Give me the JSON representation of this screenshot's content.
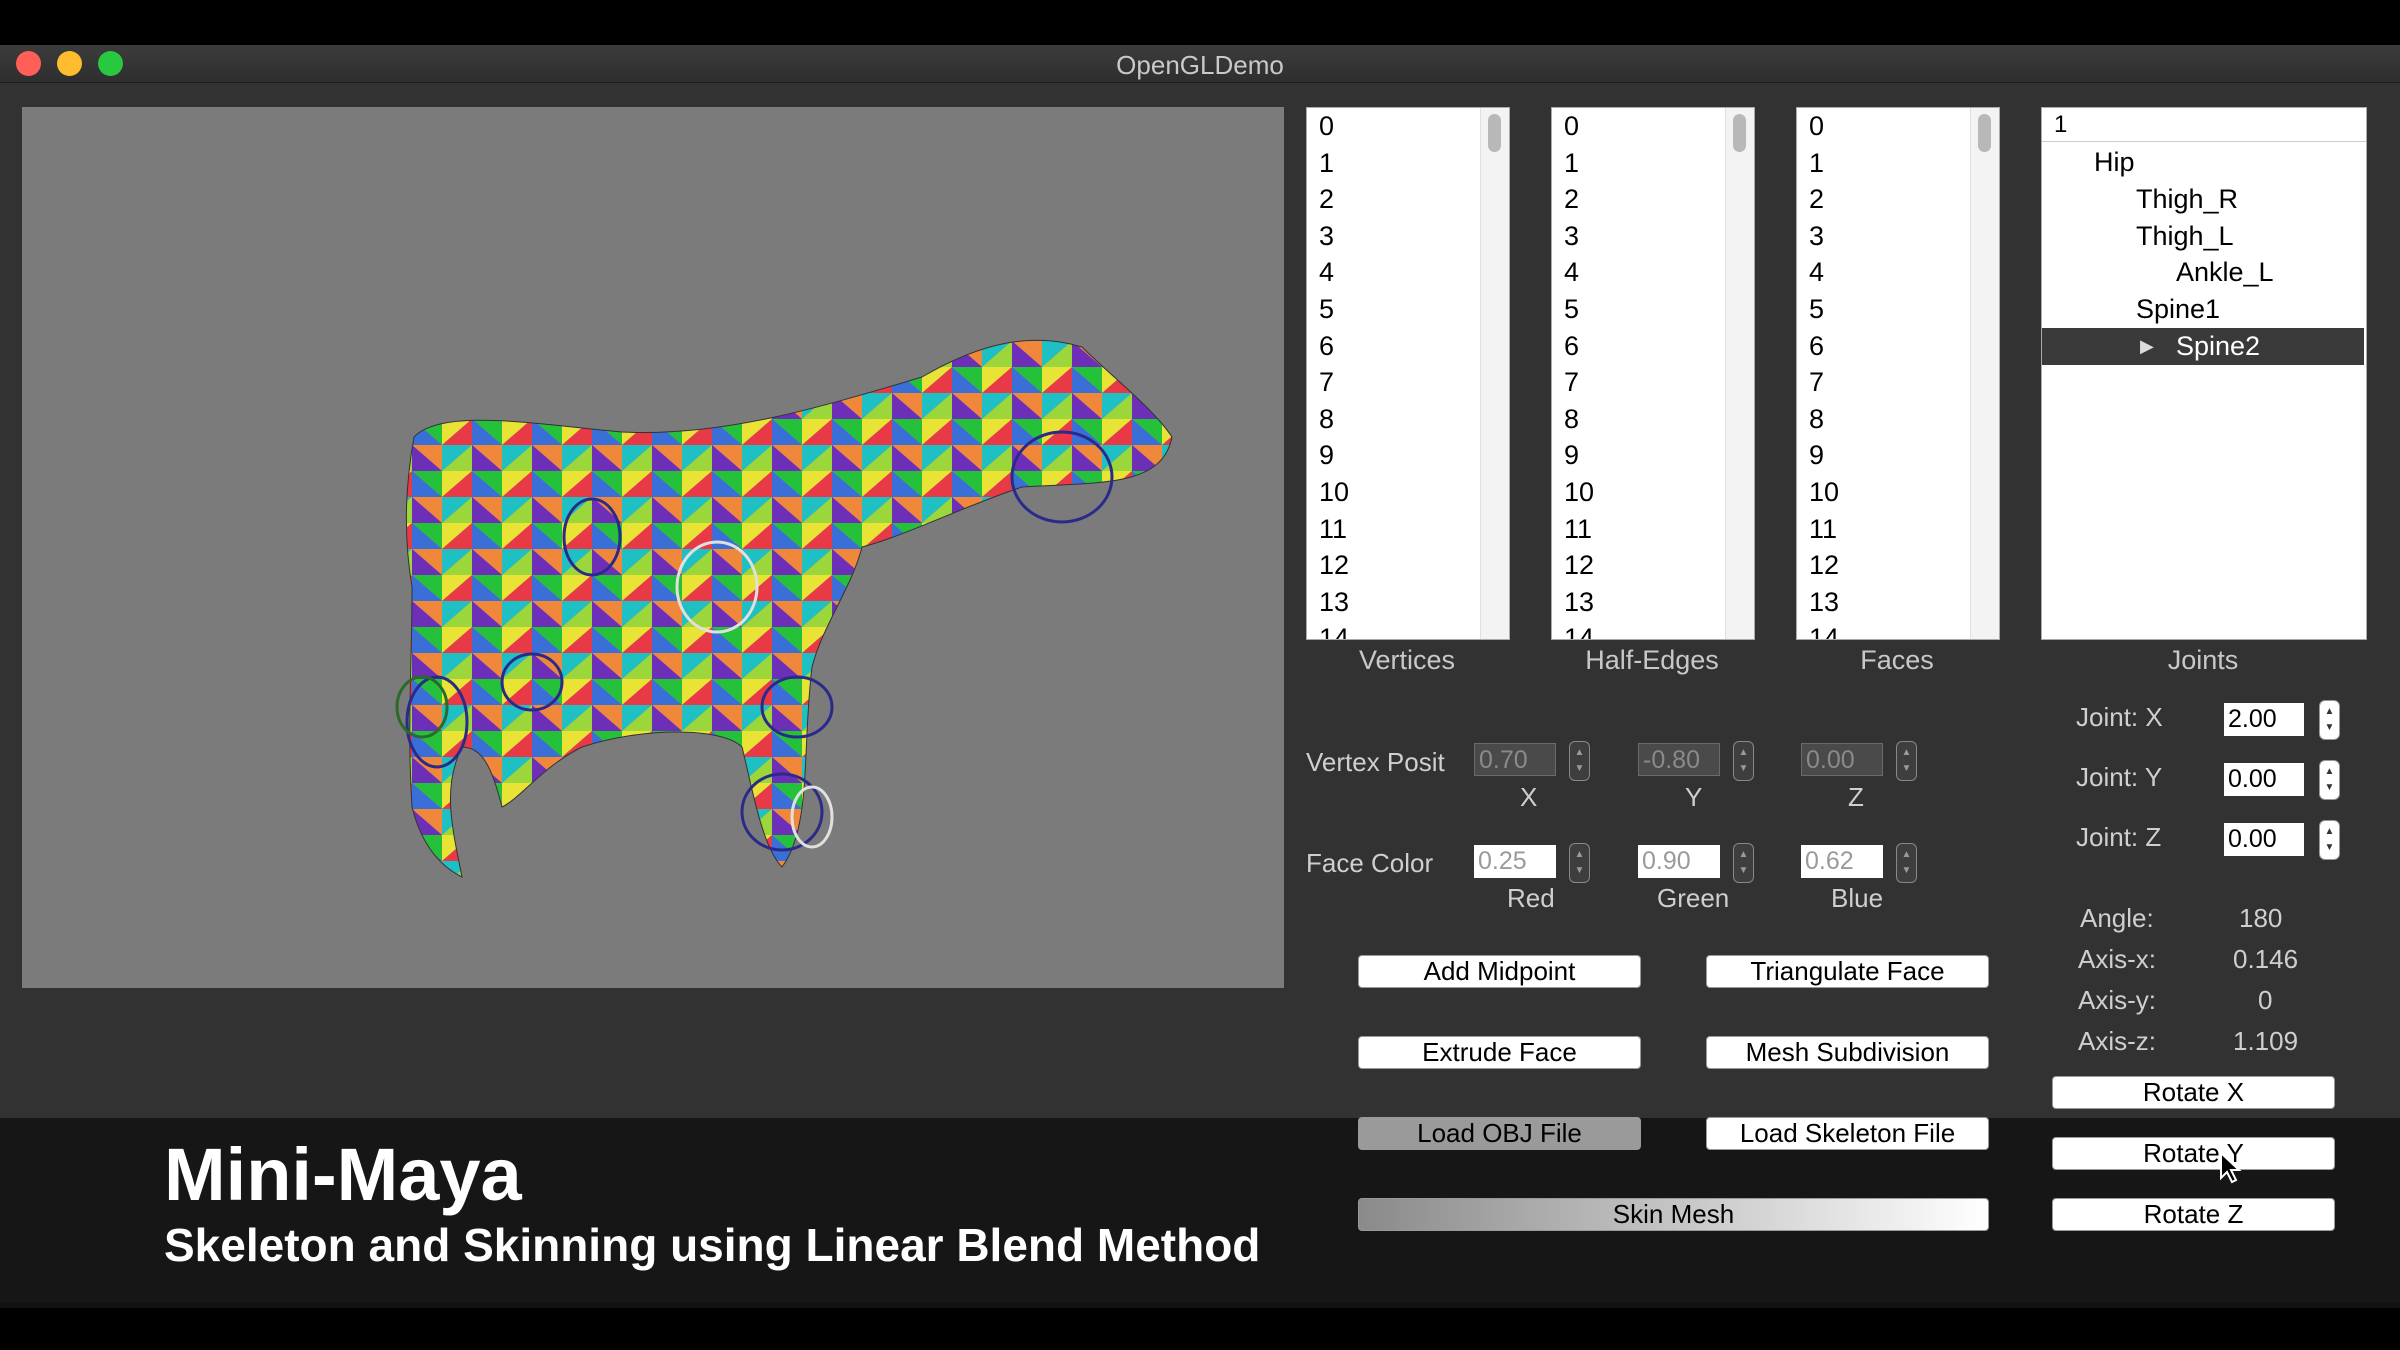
{
  "window": {
    "title": "OpenGLDemo"
  },
  "lists": {
    "vertices": {
      "items": [
        "0",
        "1",
        "2",
        "3",
        "4",
        "5",
        "6",
        "7",
        "8",
        "9",
        "10",
        "11",
        "12",
        "13",
        "14"
      ],
      "caption": "Vertices"
    },
    "half_edges": {
      "items": [
        "0",
        "1",
        "2",
        "3",
        "4",
        "5",
        "6",
        "7",
        "8",
        "9",
        "10",
        "11",
        "12",
        "13",
        "14"
      ],
      "caption": "Half-Edges"
    },
    "faces": {
      "items": [
        "0",
        "1",
        "2",
        "3",
        "4",
        "5",
        "6",
        "7",
        "8",
        "9",
        "10",
        "11",
        "12",
        "13",
        "14"
      ],
      "caption": "Faces"
    }
  },
  "joints": {
    "caption": "Joints",
    "header": "1",
    "tree": [
      "Hip",
      "Thigh_R",
      "Thigh_L",
      "Ankle_L",
      "Spine1",
      "Spine2"
    ],
    "selected": "Spine2",
    "x_label": "Joint: X",
    "x_value": "2.00",
    "y_label": "Joint: Y",
    "y_value": "0.00",
    "z_label": "Joint: Z",
    "z_value": "0.00"
  },
  "vertex_position": {
    "label": "Vertex Posit",
    "x": "0.70",
    "y": "-0.80",
    "z": "0.00",
    "x_label": "X",
    "y_label": "Y",
    "z_label": "Z"
  },
  "face_color": {
    "label": "Face Color",
    "red": "0.25",
    "green": "0.90",
    "blue": "0.62",
    "red_label": "Red",
    "green_label": "Green",
    "blue_label": "Blue"
  },
  "rotation_info": {
    "angle_label": "Angle:",
    "angle": "180",
    "axis_x_label": "Axis-x:",
    "axis_x": "0.146",
    "axis_y_label": "Axis-y:",
    "axis_y": "0",
    "axis_z_label": "Axis-z:",
    "axis_z": "1.109"
  },
  "buttons": {
    "add_midpoint": "Add Midpoint",
    "triangulate_face": "Triangulate Face",
    "extrude_face": "Extrude Face",
    "mesh_subdivision": "Mesh Subdivision",
    "load_obj": "Load OBJ File",
    "load_skeleton": "Load Skeleton File",
    "skin_mesh": "Skin Mesh",
    "rotate_x": "Rotate X",
    "rotate_y": "Rotate Y",
    "rotate_z": "Rotate Z"
  },
  "overlay": {
    "title": "Mini-Maya",
    "subtitle": "Skeleton and Skinning using Linear Blend Method"
  },
  "colors": {
    "window_bg": "#323232",
    "viewport_bg": "#7b7b7b",
    "selection": "#3a3a3a",
    "close": "#ff5f57",
    "minimize": "#febc2e",
    "zoom": "#28c840"
  }
}
